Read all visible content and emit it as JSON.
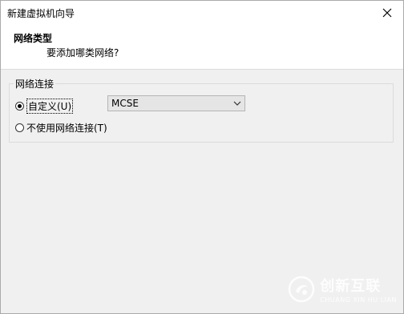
{
  "window": {
    "title": "新建虚拟机向导"
  },
  "header": {
    "title": "网络类型",
    "subtitle": "要添加哪类网络?"
  },
  "network_group": {
    "legend": "网络连接",
    "options": [
      {
        "label": "自定义(U)",
        "checked": true
      },
      {
        "label": "不使用网络连接(T)",
        "checked": false
      }
    ],
    "custom_select_value": "MCSE"
  },
  "watermark": {
    "text": "创新互联",
    "subtext": "CHUANG XIN HU LIAN"
  },
  "icons": {
    "close": "close-icon",
    "dropdown": "chevron-down-icon",
    "watermark_logo": "logo-icon"
  }
}
